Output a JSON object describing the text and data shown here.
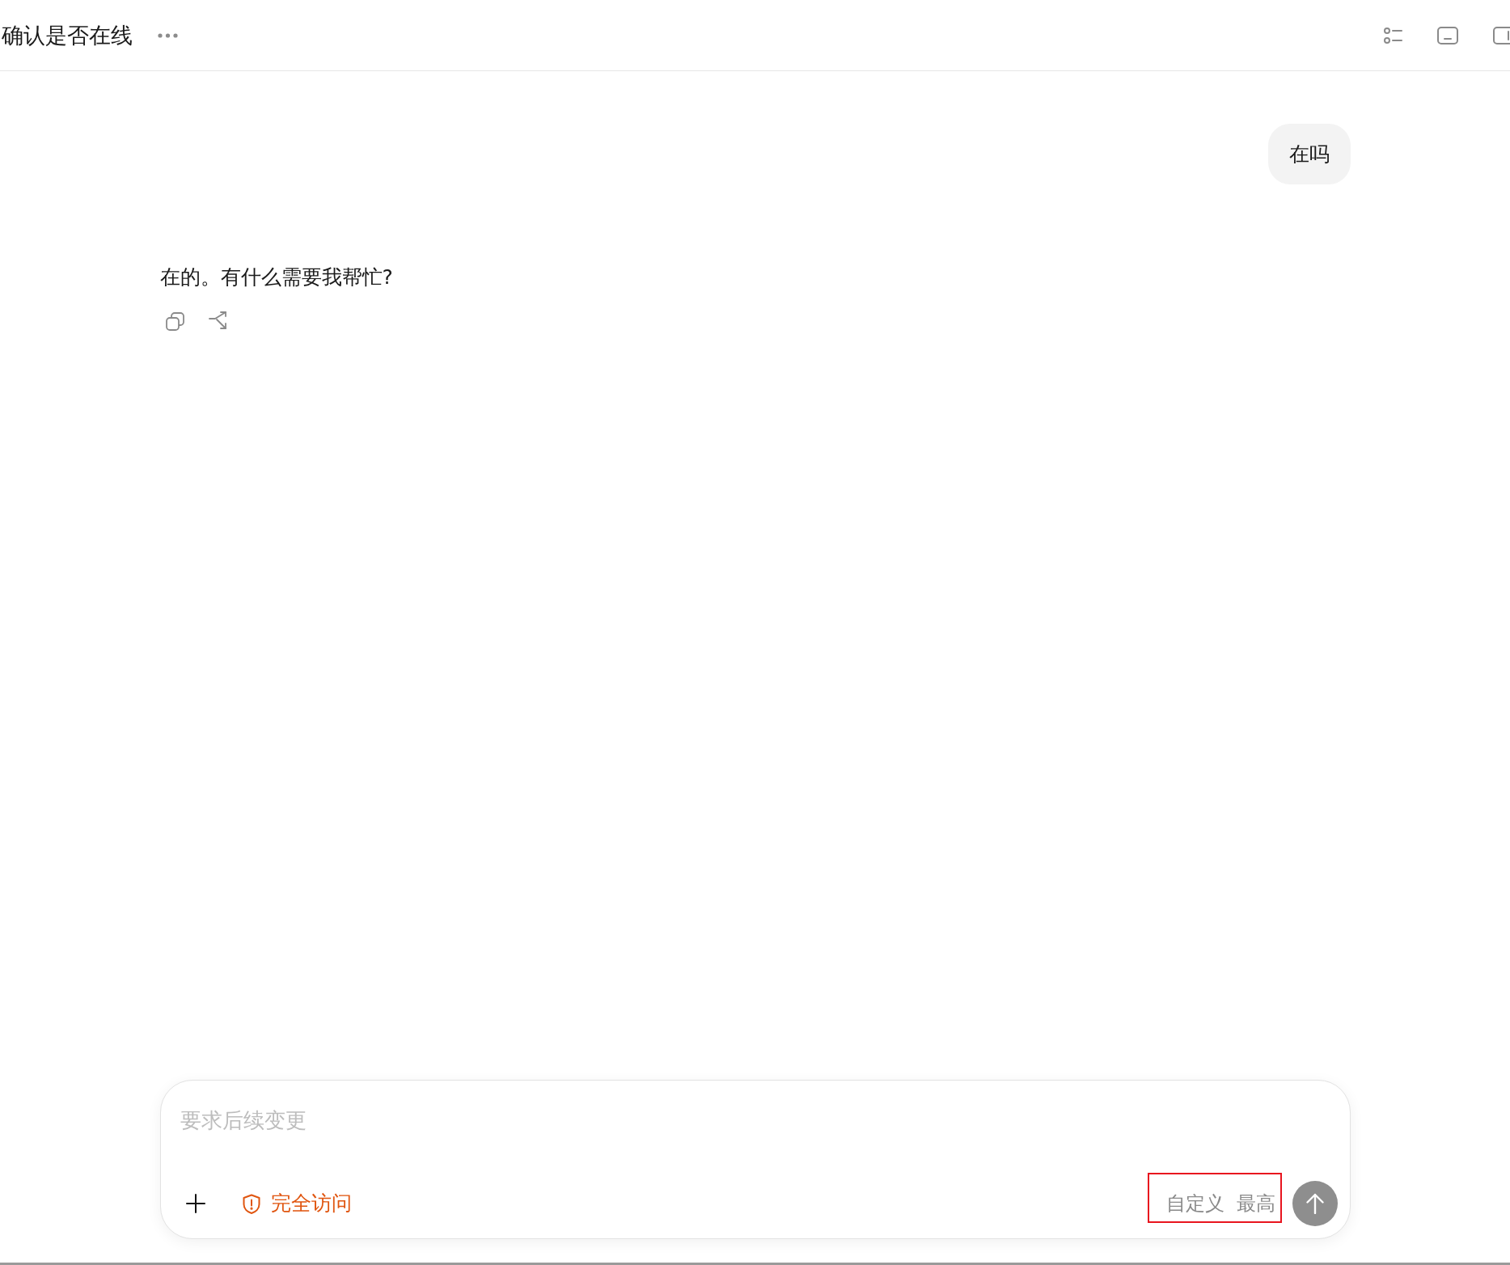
{
  "header": {
    "title": "确认是否在线"
  },
  "messages": [
    {
      "kind": "user",
      "text": "在吗"
    },
    {
      "kind": "assistant",
      "text": "在的。有什么需要我帮忙?"
    }
  ],
  "composer": {
    "placeholder": "要求后续变更",
    "access_label": "完全访问",
    "model_picker": {
      "highlighted": true,
      "model_label": "自定义",
      "effort_label": "最高"
    }
  }
}
